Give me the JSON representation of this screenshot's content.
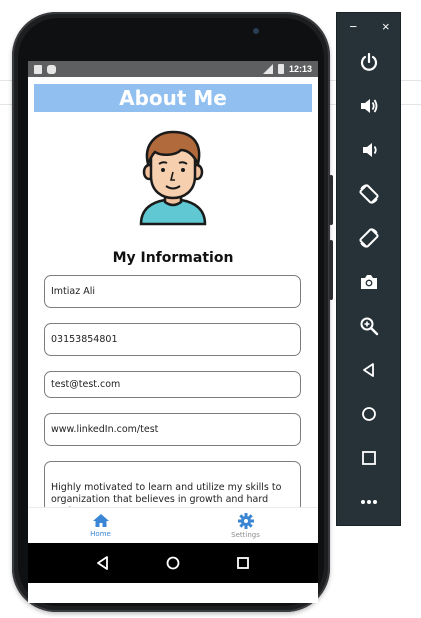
{
  "status_bar": {
    "time": "12:13",
    "network": "4G"
  },
  "app": {
    "title": "About Me",
    "section_title": "My Information",
    "fields": {
      "name": "Imtiaz Ali",
      "phone": "03153854801",
      "email": "test@test.com",
      "website": "www.linkedIn.com/test",
      "bio": "Highly motivated to learn and utilize my skills to organization that believes in growth and hard work."
    },
    "tabs": [
      {
        "label": "Home",
        "icon": "home-icon",
        "active": true
      },
      {
        "label": "Settings",
        "icon": "gear-icon",
        "active": false
      }
    ]
  },
  "colors": {
    "title_bar": "#90bff0",
    "active_tab": "#3a86d4",
    "emulator_panel": "#263238"
  },
  "emulator": {
    "window_controls": {
      "minimize": "−",
      "close": "×"
    },
    "tools": [
      "power-icon",
      "volume-up-icon",
      "volume-down-icon",
      "rotate-left-icon",
      "rotate-right-icon",
      "camera-icon",
      "zoom-icon",
      "back-icon",
      "home-circle-icon",
      "overview-icon",
      "more-icon"
    ]
  }
}
